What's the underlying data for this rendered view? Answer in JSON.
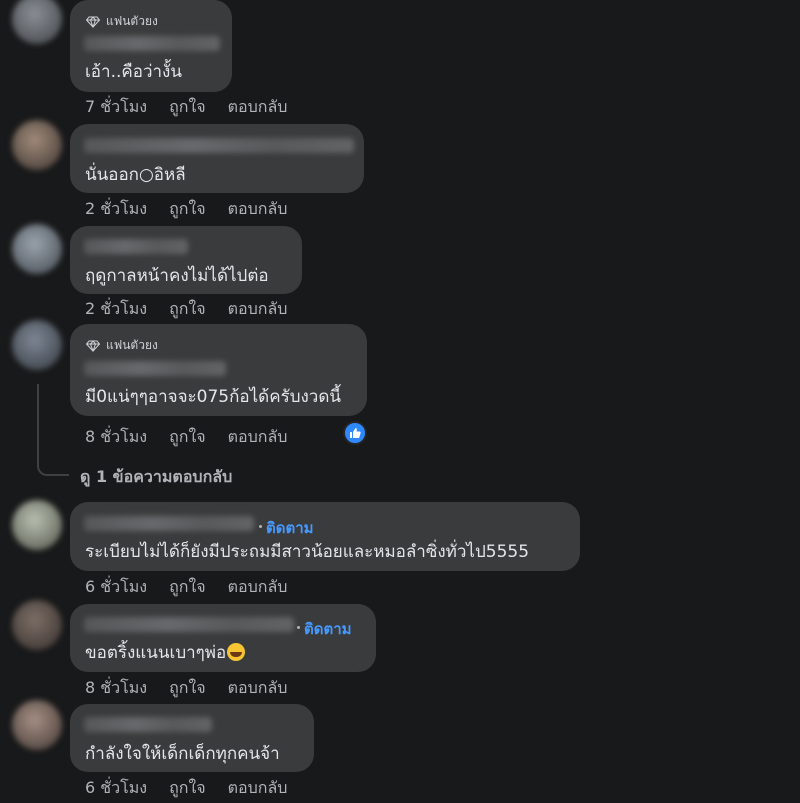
{
  "actions": {
    "like": "ถูกใจ",
    "reply": "ตอบกลับ"
  },
  "badge_label": "แฟนตัวยง",
  "follow_label": "ติดตาม",
  "view_replies": "ดู 1 ข้อความตอบกลับ",
  "colors": {
    "background": "#18191a",
    "bubble": "#3a3b3c",
    "link": "#4599ff",
    "muted": "#b0b3b8",
    "like_badge": "#2e89ff"
  },
  "comments": [
    {
      "text": "เอ้า..คือว่างั้น",
      "time": "7 ชั่วโมง",
      "top_fan": true,
      "follow": false
    },
    {
      "text": "นั่นออก○อิหลี",
      "time": "2 ชั่วโมง",
      "top_fan": false,
      "follow": false
    },
    {
      "text": "ฤดูกาลหน้าคงไม่ได้ไปต่อ",
      "time": "2 ชั่วโมง",
      "top_fan": false,
      "follow": false
    },
    {
      "text": "มี0แน่ๆๆอาจจะ075ก้อได้ครับงวดนี้",
      "time": "8 ชั่วโมง",
      "top_fan": true,
      "follow": false,
      "reactions": [
        "like-icon"
      ]
    },
    {
      "text": "ระเบียบไม่ได้ก็ยังมีประถมมีสาวน้อยและหมอลำซิ่งทั่วไป5555",
      "time": "6 ชั่วโมง",
      "top_fan": false,
      "follow": true
    },
    {
      "text": "ขอตริ้งแนนเบาๆพ่อ",
      "emoji": "rolling-laughing-emoji",
      "time": "8 ชั่วโมง",
      "top_fan": false,
      "follow": true
    },
    {
      "text": "กำลังใจให้เด็กเด็กทุกคนจ้า",
      "time": "6 ชั่วโมง",
      "top_fan": false,
      "follow": false
    }
  ]
}
